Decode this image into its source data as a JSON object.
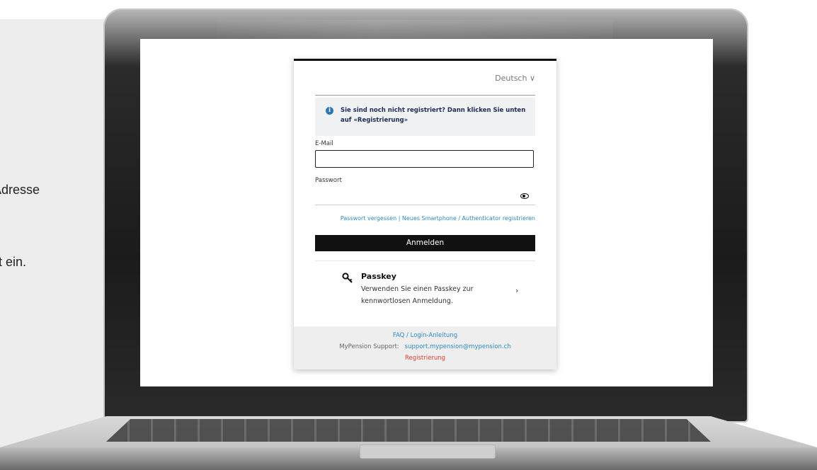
{
  "background": {
    "left_text_1": "Adresse",
    "left_text_2": "t ein."
  },
  "login": {
    "language": "Deutsch ∨",
    "info_icon": "info-icon",
    "info_message": "Sie sind noch nicht registriert? Dann klicken Sie unten auf «Registrierung»",
    "email_label": "E-Mail",
    "email_value": "",
    "password_label": "Passwort",
    "password_value": "",
    "forgot_password": "Passwort vergessen | Neues Smartphone / Authenticator registrieren",
    "login_button": "Anmelden",
    "passkey_title": "Passkey",
    "passkey_description": "Verwenden Sie einen Passkey zur kennwortlosen Anmeldung.",
    "chevron": "›"
  },
  "footer": {
    "faq": "FAQ / Login-Anleitung",
    "support_label": "MyPension Support:",
    "support_email": "support.mypension@mypension.ch",
    "register": "Registrierung"
  },
  "colors": {
    "accent_blue": "#2a8ac4",
    "register_red": "#e43a2d",
    "button_black": "#111111"
  }
}
